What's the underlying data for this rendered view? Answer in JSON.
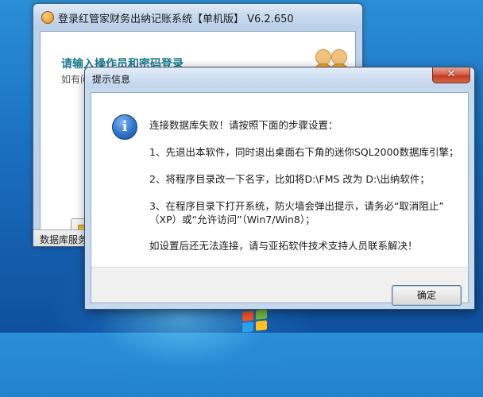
{
  "main_window": {
    "title": "登录红管家财务出纳记账系统【单机版】 V6.2.650",
    "heading": "请输入操作员和密码登录",
    "subtext": "如有问",
    "status_text": "数据库服务",
    "icons": [
      "app-icon",
      "users-icon",
      "login-icon"
    ]
  },
  "dialog": {
    "title": "提示信息",
    "close_symbol": "✕",
    "icon": "info-icon",
    "info_glyph": "i",
    "lines": [
      "连接数据库失败！请按照下面的步骤设置：",
      "1、先退出本软件，同时退出桌面右下角的迷你SQL2000数据库引擎；",
      "2、将程序目录改一下名字，比如将D:\\FMS 改为 D:\\出纳软件；",
      "3、在程序目录下打开系统，防火墙会弹出提示，请务必“取消阻止”",
      "（XP）或“允许访问”（Win7/Win8）；",
      "如设置后还无法连接，请与亚拓软件技术支持人员联系解决！"
    ],
    "ok_label": "确定"
  },
  "colors": {
    "heading": "#1a7b8f",
    "desktop": "#1a6fbe",
    "close_button": "#c13b22"
  }
}
